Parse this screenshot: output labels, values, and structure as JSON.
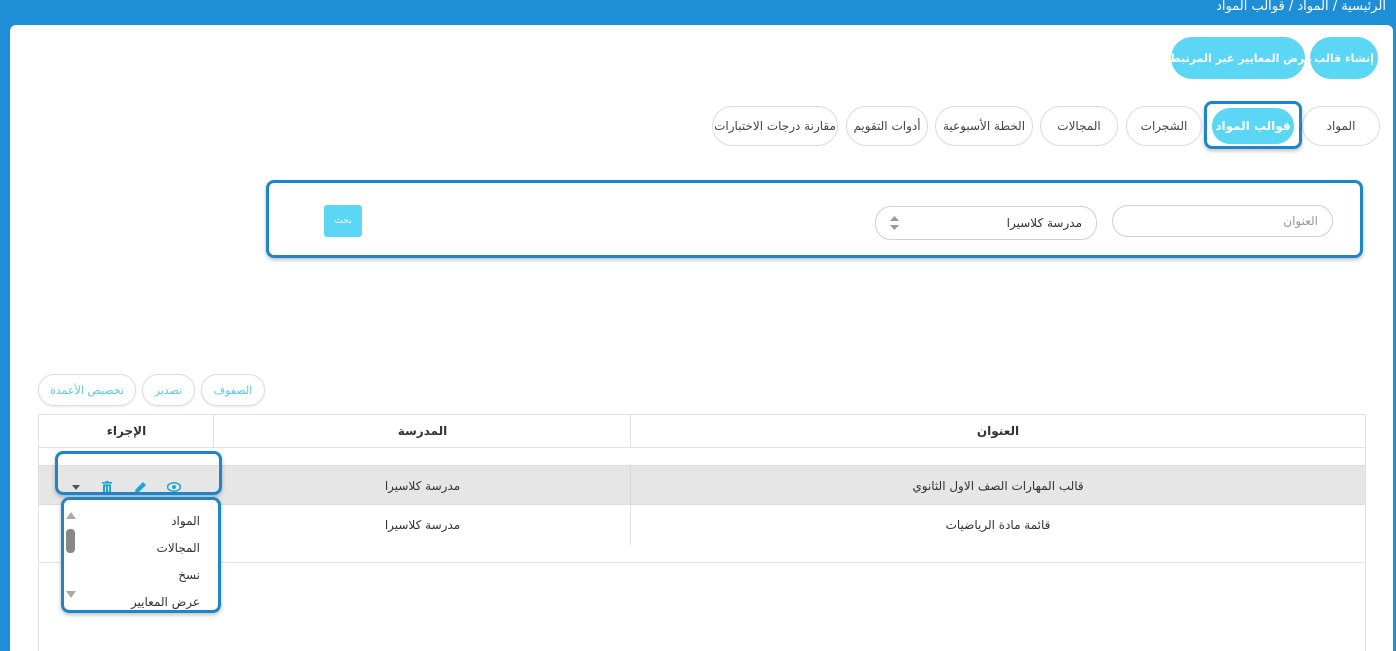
{
  "breadcrumb": {
    "text": "الرئيسية / المواد / قوالب المواد"
  },
  "header_actions": {
    "create_template": "إنشاء قالب",
    "view_unlinked_criteria": "عرض المعايير غير المرتبطة"
  },
  "tabs": [
    {
      "label": "المواد",
      "active": false
    },
    {
      "label": "قوالب المواد",
      "active": true
    },
    {
      "label": "الشجرات",
      "active": false
    },
    {
      "label": "المجالات",
      "active": false
    },
    {
      "label": "الخطة الأسبوعية",
      "active": false
    },
    {
      "label": "أدوات التقويم",
      "active": false
    },
    {
      "label": "مقارنة درجات الاختبارات",
      "active": false
    }
  ],
  "filters": {
    "title_placeholder": "العنوان",
    "school_value": "مدرسة كلاسيرا",
    "search_button": "بحث"
  },
  "toolbar": {
    "rows": "الصفوف",
    "export": "تصدير",
    "customize_columns": "تخصيص الأعمدة"
  },
  "table": {
    "headers": {
      "title": "العنوان",
      "school": "المدرسة",
      "action": "الإجراء"
    },
    "rows": [
      {
        "title": "قالب المهارات الصف الاول الثانوي",
        "school": "مدرسة كلاسيرا",
        "selected": true
      },
      {
        "title": "قائمة مادة الرياضيات",
        "school": "مدرسة كلاسيرا",
        "selected": false
      }
    ]
  },
  "action_menu": {
    "items": [
      "المواد",
      "المجالات",
      "نسخ",
      "عرض المعايير"
    ]
  },
  "colors": {
    "frame": "#1e8fd6",
    "accent": "#5bd6f5",
    "highlight_border": "#1e86c8",
    "selected_row": "#e6e6e6",
    "icon": "#1aa6d6"
  }
}
